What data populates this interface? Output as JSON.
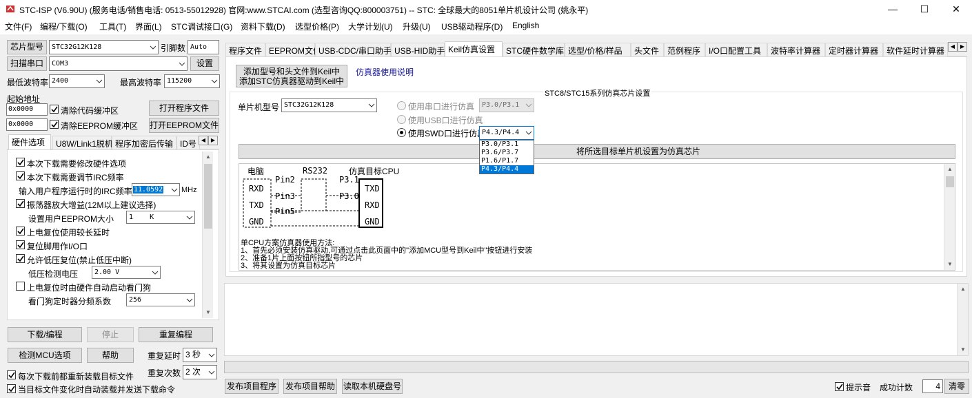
{
  "window": {
    "title": "STC-ISP (V6.90U) (服务电话/销售电话: 0513-55012928) 官网:www.STCAI.com  (选型咨询QQ:800003751) -- STC: 全球最大的8051单片机设计公司 (姚永平)",
    "minimize": "—",
    "maximize": "☐",
    "close": "✕"
  },
  "menu": [
    "文件(F)",
    "编程/下载(O)",
    "工具(T)",
    "界面(L)",
    "STC调试接口(G)",
    "资料下载(D)",
    "选型价格(P)",
    "大学计划(U)",
    "升级(U)",
    "USB驱动程序(D)",
    "English"
  ],
  "left": {
    "chip_label": "芯片型号",
    "chip_value": "STC32G12K128",
    "pins_label": "引脚数",
    "pins_value": "Auto",
    "scan_label": "扫描串口",
    "port_value": "COM3",
    "settings_label": "设置",
    "min_baud_label": "最低波特率",
    "min_baud_value": "2400",
    "max_baud_label": "最高波特率",
    "max_baud_value": "115200",
    "start_addr_label": "起始地址",
    "addr1": "0x0000",
    "clear_code_label": "清除代码缓冲区",
    "open_prog_label": "打开程序文件",
    "addr2": "0x0000",
    "clear_eeprom_label": "清除EEPROM缓冲区",
    "open_eeprom_label": "打开EEPROM文件",
    "tabs": [
      "硬件选项",
      "U8W/Link1脱机",
      "程序加密后传输",
      "ID号"
    ],
    "hw": {
      "opt1": "本次下载需要修改硬件选项",
      "opt2": "本次下载需要调节IRC频率",
      "irc_label": "输入用户程序运行时的IRC频率",
      "irc_value": "11.0592",
      "irc_unit": "MHz",
      "opt3": "振荡器放大增益(12M以上建议选择)",
      "eeprom_size_label": "设置用户EEPROM大小",
      "eeprom_size_value": "1    K",
      "opt4": "上电复位使用较长延时",
      "opt5": "复位脚用作I/O口",
      "opt6": "允许低压复位(禁止低压中断)",
      "lv_label": "低压检测电压",
      "lv_value": "2.00 V",
      "opt7": "上电复位时由硬件自动启动看门狗",
      "wdt_label": "看门狗定时器分频系数",
      "wdt_value": "256"
    },
    "download_label": "下载/编程",
    "stop_label": "停止",
    "reprog_label": "重复编程",
    "detect_label": "检测MCU选项",
    "help_label": "帮助",
    "repeat_delay_label": "重复延时",
    "repeat_delay_value": "3 秒",
    "repeat_count_label": "重复次数",
    "repeat_count_value": "2 次",
    "reload_label": "每次下载前都重新装载目标文件",
    "auto_load_label": "当目标文件变化时自动装载并发送下载命令"
  },
  "right": {
    "tabs": [
      "程序文件",
      "EEPROM文件",
      "USB-CDC/串口助手",
      "USB-HID助手",
      "Keil仿真设置",
      "STC硬件数学库",
      "选型/价格/样品",
      "头文件",
      "范例程序",
      "I/O口配置工具",
      "波特率计算器",
      "定时器计算器",
      "软件延时计算器"
    ],
    "add_btn_line1": "添加型号和头文件到Keil中",
    "add_btn_line2": "添加STC仿真器驱动到Keil中",
    "usage_link": "仿真器使用说明",
    "group_title": "STC8/STC15系列仿真芯片设置",
    "mcu_label": "单片机型号",
    "mcu_value": "STC32G12K128",
    "r_serial": "使用串口进行仿真",
    "serial_value": "P3.0/P3.1",
    "r_usb": "使用USB口进行仿真",
    "r_swd": "使用SWD口进行仿真",
    "swd_value": "P4.3/P4.4",
    "swd_options": [
      "P3.0/P3.1",
      "P3.6/P3.7",
      "P1.6/P1.7",
      "P4.3/P4.4"
    ],
    "set_emu_label": "将所选目标单片机设置为仿真芯片",
    "diagram": {
      "pc": "电脑",
      "rs232": "RS232",
      "target": "仿真目标CPU",
      "rxd": "RXD",
      "txd": "TXD",
      "gnd": "GND",
      "pin2": "Pin2",
      "pin3": "Pin3",
      "pin5": "Pin5",
      "p31": "P3.1",
      "p30": "P3.0"
    },
    "notes": [
      "单CPU方案仿真器使用方法:",
      "1、首先必须安装仿真驱动,可通过点击此页面中的\"添加MCU型号到Keil中\"按钮进行安装",
      "2、准备1片上面按钮所指型号的芯片",
      "3、将其设置为仿真目标芯片"
    ]
  },
  "bottom": {
    "publish_prog": "发布项目程序",
    "publish_help": "发布项目帮助",
    "read_disk": "读取本机硬盘号",
    "beep_label": "提示音",
    "success_count_label": "成功计数",
    "success_count_value": "4",
    "clear_label": "清零"
  }
}
